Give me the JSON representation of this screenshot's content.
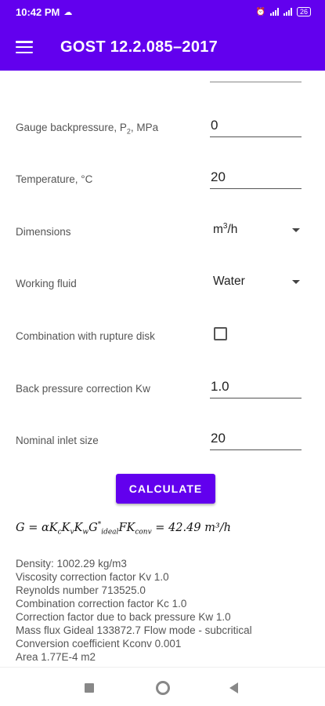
{
  "status_bar": {
    "time": "10:42 PM",
    "battery": "26"
  },
  "app_bar": {
    "title": "GOST 12.2.085–2017"
  },
  "form": {
    "backpressure": {
      "label_pre": "Gauge backpressure, P",
      "label_sub": "2",
      "label_post": ", MPa",
      "value": "0"
    },
    "temperature": {
      "label": "Temperature, °C",
      "value": "20"
    },
    "dimensions": {
      "label": "Dimensions",
      "value_base": "m",
      "value_sup": "3",
      "value_post": "/h"
    },
    "working_fluid": {
      "label": "Working fluid",
      "value": "Water"
    },
    "rupture_disk": {
      "label": "Combination with rupture disk",
      "checked": false
    },
    "back_pressure_kw": {
      "label": "Back pressure correction Kw",
      "value": "1.0"
    },
    "inlet_size": {
      "label": "Nominal inlet size",
      "value": "20"
    }
  },
  "calculate_label": "CALCULATE",
  "formula": {
    "result": "42.49",
    "units": "m³/h"
  },
  "results": [
    "Density: 1002.29 kg/m3",
    "Viscosity correction factor Kv 1.0",
    "Reynolds number 713525.0",
    "Combination correction factor Kc 1.0",
    "Correction factor due to back pressure Kw 1.0",
    "Mass flux Gideal 133872.7 Flow mode - subcritical",
    "Conversion coefficient Kconv 0.001",
    "Area 1.77E-4 m2"
  ],
  "colors": {
    "primary": "#6200ee"
  }
}
